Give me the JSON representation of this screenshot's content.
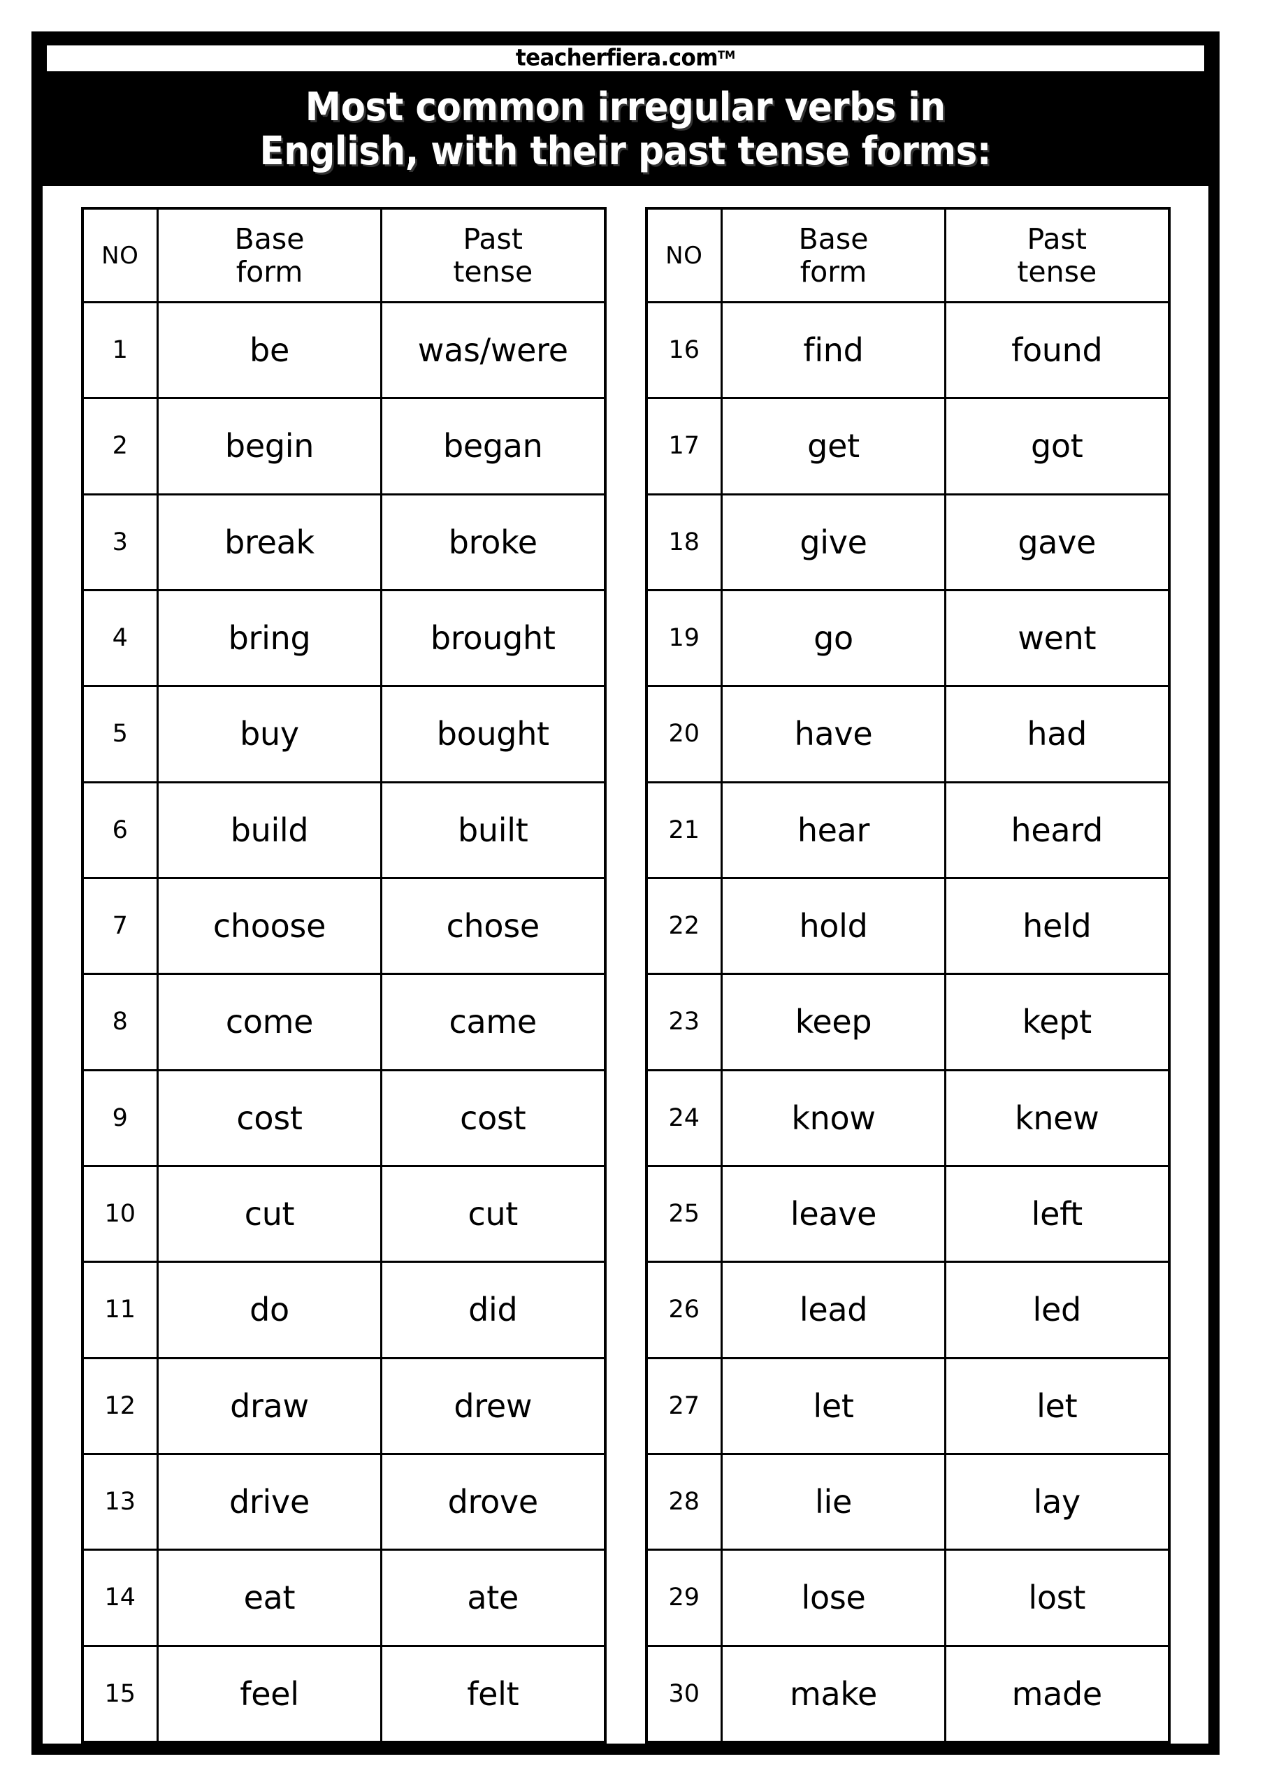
{
  "brand": {
    "name": "teacherfiera.com",
    "trademark": "TM"
  },
  "title": "Most common irregular verbs in\nEnglish, with their past tense forms:",
  "colors": {
    "ink": "#000000",
    "paper": "#ffffff"
  },
  "tables": [
    {
      "headers": {
        "no": "NO",
        "base": "Base\nform",
        "past": "Past\ntense"
      },
      "rows": [
        {
          "no": "1",
          "base": "be",
          "past": "was/were"
        },
        {
          "no": "2",
          "base": "begin",
          "past": "began"
        },
        {
          "no": "3",
          "base": "break",
          "past": "broke"
        },
        {
          "no": "4",
          "base": "bring",
          "past": "brought"
        },
        {
          "no": "5",
          "base": "buy",
          "past": "bought"
        },
        {
          "no": "6",
          "base": "build",
          "past": "built"
        },
        {
          "no": "7",
          "base": "choose",
          "past": "chose"
        },
        {
          "no": "8",
          "base": "come",
          "past": "came"
        },
        {
          "no": "9",
          "base": "cost",
          "past": "cost"
        },
        {
          "no": "10",
          "base": "cut",
          "past": "cut"
        },
        {
          "no": "11",
          "base": "do",
          "past": "did"
        },
        {
          "no": "12",
          "base": "draw",
          "past": "drew"
        },
        {
          "no": "13",
          "base": "drive",
          "past": "drove"
        },
        {
          "no": "14",
          "base": "eat",
          "past": "ate"
        },
        {
          "no": "15",
          "base": "feel",
          "past": "felt"
        }
      ]
    },
    {
      "headers": {
        "no": "NO",
        "base": "Base\nform",
        "past": "Past\ntense"
      },
      "rows": [
        {
          "no": "16",
          "base": "find",
          "past": "found"
        },
        {
          "no": "17",
          "base": "get",
          "past": "got"
        },
        {
          "no": "18",
          "base": "give",
          "past": "gave"
        },
        {
          "no": "19",
          "base": "go",
          "past": "went"
        },
        {
          "no": "20",
          "base": "have",
          "past": "had"
        },
        {
          "no": "21",
          "base": "hear",
          "past": "heard"
        },
        {
          "no": "22",
          "base": "hold",
          "past": "held"
        },
        {
          "no": "23",
          "base": "keep",
          "past": "kept"
        },
        {
          "no": "24",
          "base": "know",
          "past": "knew"
        },
        {
          "no": "25",
          "base": "leave",
          "past": "left"
        },
        {
          "no": "26",
          "base": "lead",
          "past": "led"
        },
        {
          "no": "27",
          "base": "let",
          "past": "let"
        },
        {
          "no": "28",
          "base": "lie",
          "past": "lay"
        },
        {
          "no": "29",
          "base": "lose",
          "past": "lost"
        },
        {
          "no": "30",
          "base": "make",
          "past": "made"
        }
      ]
    }
  ]
}
